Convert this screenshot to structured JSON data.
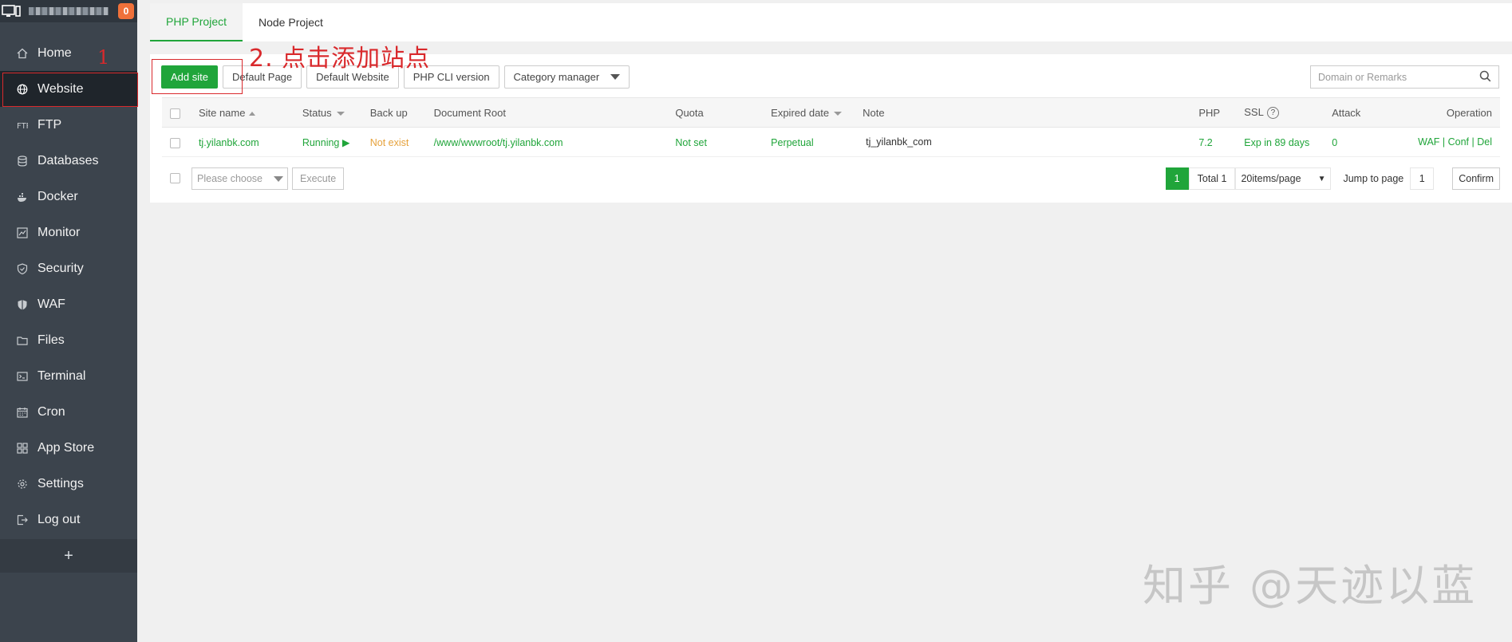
{
  "sidebar": {
    "badge": "0",
    "items": [
      {
        "label": "Home",
        "icon": "home-icon"
      },
      {
        "label": "Website",
        "icon": "globe-icon",
        "active": true
      },
      {
        "label": "FTP",
        "icon": "ftp-icon"
      },
      {
        "label": "Databases",
        "icon": "database-icon"
      },
      {
        "label": "Docker",
        "icon": "docker-icon"
      },
      {
        "label": "Monitor",
        "icon": "monitor-chart-icon"
      },
      {
        "label": "Security",
        "icon": "shield-check-icon"
      },
      {
        "label": "WAF",
        "icon": "shield-icon"
      },
      {
        "label": "Files",
        "icon": "folder-icon"
      },
      {
        "label": "Terminal",
        "icon": "terminal-icon"
      },
      {
        "label": "Cron",
        "icon": "calendar-icon"
      },
      {
        "label": "App Store",
        "icon": "grid-icon"
      },
      {
        "label": "Settings",
        "icon": "gear-icon"
      },
      {
        "label": "Log out",
        "icon": "logout-icon"
      }
    ],
    "add_label": "+"
  },
  "annotations": {
    "step1": "1",
    "step2": "2. 点击添加站点"
  },
  "tabs": [
    "PHP Project",
    "Node Project"
  ],
  "toolbar": {
    "add_site": "Add site",
    "default_page": "Default Page",
    "default_website": "Default Website",
    "php_cli": "PHP CLI version",
    "category": "Category manager"
  },
  "search": {
    "placeholder": "Domain or Remarks"
  },
  "table": {
    "headers": {
      "site_name": "Site name",
      "status": "Status",
      "backup": "Back up",
      "doc_root": "Document Root",
      "quota": "Quota",
      "expired": "Expired date",
      "note": "Note",
      "php": "PHP",
      "ssl": "SSL",
      "attack": "Attack",
      "operation": "Operation"
    },
    "rows": [
      {
        "site_name": "tj.yilanbk.com",
        "status": "Running",
        "backup": "Not exist",
        "doc_root": "/www/wwwroot/tj.yilanbk.com",
        "quota": "Not set",
        "expired": "Perpetual",
        "note": "tj_yilanbk_com",
        "php": "7.2",
        "ssl": "Exp in 89 days",
        "attack": "0",
        "op_waf": "WAF",
        "op_conf": "Conf",
        "op_del": "Del"
      }
    ]
  },
  "bottom": {
    "choose_placeholder": "Please choose",
    "execute": "Execute",
    "page": "1",
    "total": "Total 1",
    "page_size": "20items/page",
    "jump_label": "Jump to page",
    "jump_value": "1",
    "confirm": "Confirm"
  },
  "watermark": "知乎 @天迹以蓝",
  "colors": {
    "accent": "#20a53a",
    "annotation": "#d9292c",
    "warning": "#e6a23c",
    "sidebar": "#3c444d"
  }
}
